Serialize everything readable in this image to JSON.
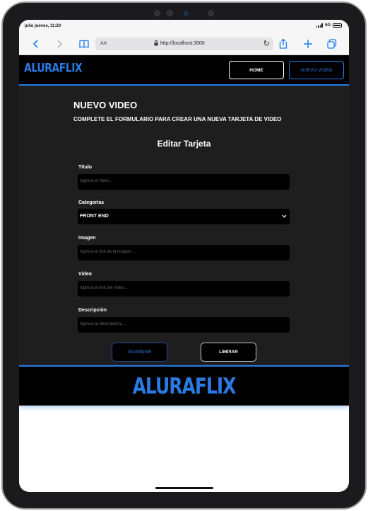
{
  "status_bar": {
    "time": "julio jueves, 11:20",
    "network": "5G"
  },
  "browser": {
    "aa_label": "AA",
    "url": "http://localhost:3000"
  },
  "header": {
    "logo": "ALURAFLIX",
    "nav": {
      "home_label": "HOME",
      "new_video_label": "NUEVO VIDEO"
    }
  },
  "form": {
    "title": "NUEVO VIDEO",
    "subtitle": "COMPLETE EL FORMULARIO PARA CREAR UNA NUEVA TARJETA DE VIDEO",
    "card_title": "Editar Tarjeta",
    "fields": {
      "titulo": {
        "label": "Título",
        "placeholder": "ingresa el título..."
      },
      "categorias": {
        "label": "Categorías",
        "value": "FRONT END"
      },
      "imagen": {
        "label": "Imagen",
        "placeholder": "ingresa el link de la imagen..."
      },
      "video": {
        "label": "Video",
        "placeholder": "ingresa el link del video..."
      },
      "descripcion": {
        "label": "Descripción",
        "placeholder": "ingresa la descripción..."
      }
    },
    "buttons": {
      "save_label": "GUARDAR",
      "clear_label": "LIMPIAR"
    }
  },
  "footer": {
    "logo": "ALURAFLIX"
  },
  "colors": {
    "accent": "#2a7ae4",
    "page_bg": "#1e1e1e",
    "header_bg": "#000000"
  }
}
